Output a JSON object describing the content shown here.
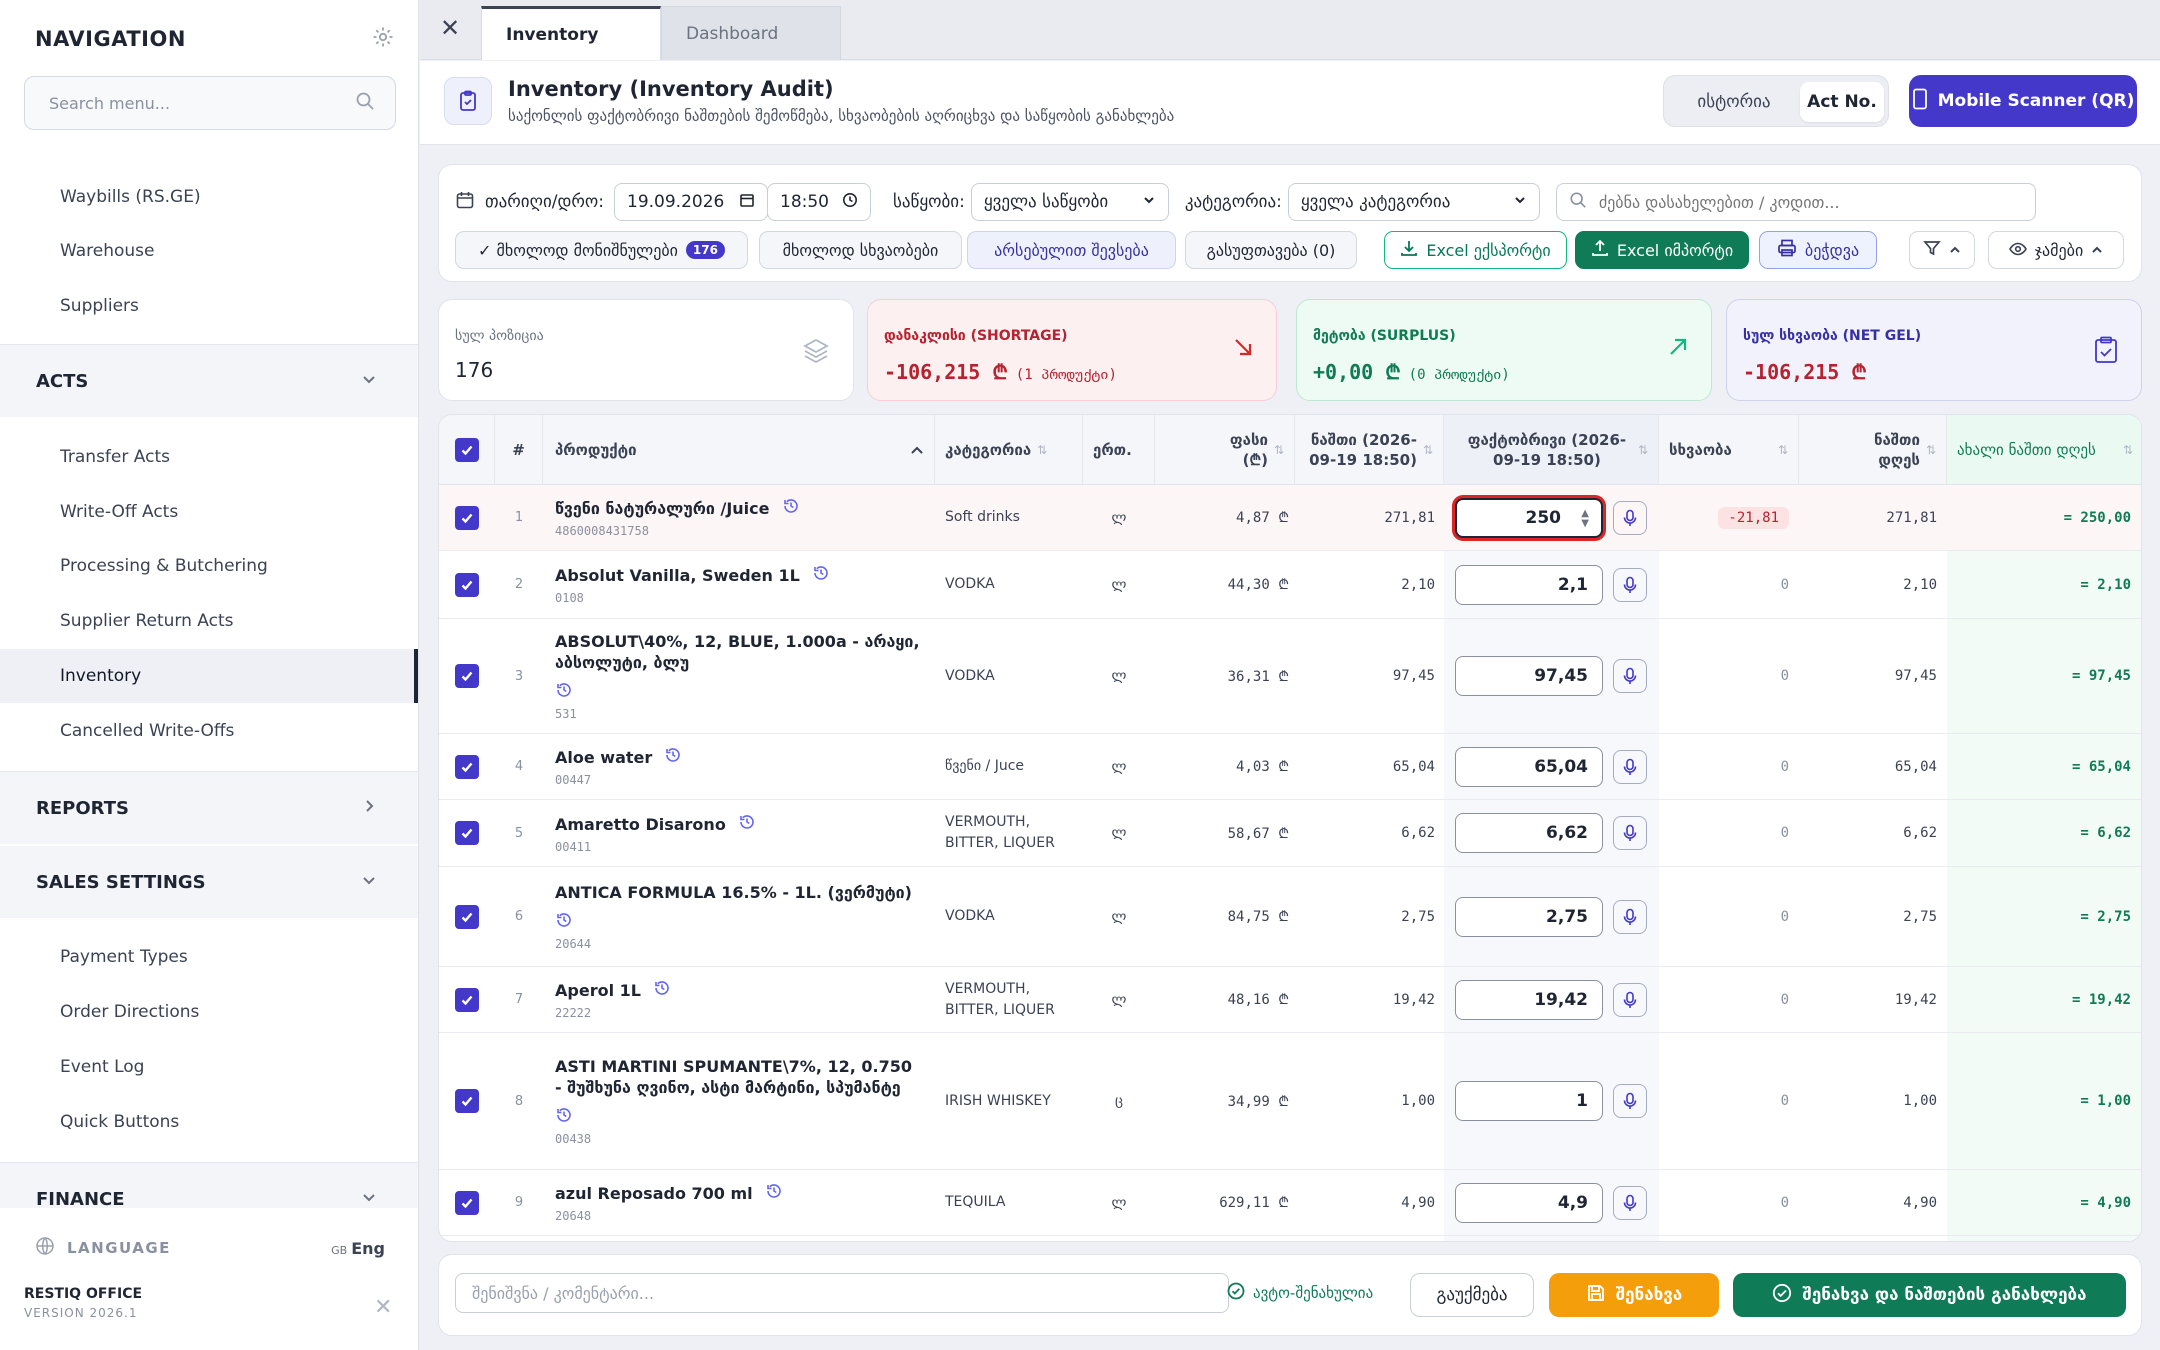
{
  "sidebar": {
    "title": "NAVIGATION",
    "search_placeholder": "Search menu...",
    "items_top": [
      "Waybills (RS.GE)",
      "Warehouse",
      "Suppliers"
    ],
    "acts_label": "ACTS",
    "acts_items": [
      "Transfer Acts",
      "Write-Off Acts",
      "Processing & Butchering",
      "Supplier Return Acts",
      "Inventory",
      "Cancelled Write-Offs"
    ],
    "reports_label": "REPORTS",
    "sales_label": "SALES SETTINGS",
    "sales_items": [
      "Payment Types",
      "Order Directions",
      "Event Log",
      "Quick Buttons"
    ],
    "finance_label": "FINANCE",
    "language_label": "LANGUAGE",
    "language_flag": "GB",
    "language_value": "Eng",
    "brand": "RESTIQ OFFICE",
    "version": "VERSION 2026.1"
  },
  "tabs": {
    "active": "Inventory",
    "inactive": "Dashboard"
  },
  "header": {
    "title": "Inventory (Inventory Audit)",
    "subtitle": "საქონლის ფაქტობრივი ნაშთების შემოწმება, სხვაობების აღრიცხვა და საწყობის განახლება",
    "history": "ისტორია",
    "act_no": "Act No.",
    "scanner": "Mobile Scanner (QR)"
  },
  "filters": {
    "date_label": "თარიღი/დრო:",
    "date_value": "19.09.2026",
    "time_value": "18:50",
    "warehouse_label": "საწყობი:",
    "warehouse_value": "ყველა საწყობი",
    "category_label": "კატეგორია:",
    "category_value": "ყველა კატეგორია",
    "search_placeholder": "ძებნა დასახელებით / კოდით...",
    "chip_marked": "✓ მხოლოდ მონიშნულები",
    "chip_marked_count": "176",
    "chip_diff": "მხოლოდ სხვაობები",
    "chip_fill": "არსებულით შევსება",
    "chip_clear": "გასუფთავება (0)",
    "excel_export": "Excel ექსპორტი",
    "excel_import": "Excel იმპორტი",
    "print": "ბეჭდვა",
    "totals": "ჯამები"
  },
  "stats": {
    "positions_label": "სულ პოზიცია",
    "positions_value": "176",
    "shortage_label": "დანაკლისი (SHORTAGE)",
    "shortage_value": "-106,215 ₾",
    "shortage_note": "(1 პროდუქტი)",
    "surplus_label": "მეტობა (SURPLUS)",
    "surplus_value": "+0,00 ₾",
    "surplus_note": "(0 პროდუქტი)",
    "net_label": "სულ სხვაობა (NET GEL)",
    "net_value": "-106,215 ₾"
  },
  "table": {
    "headers": {
      "num": "#",
      "product": "პროდუქტი",
      "category": "კატეგორია",
      "unit": "ერთ.",
      "price": "ფასი (₾)",
      "balance": "ნაშთი (2026-09-19 18:50)",
      "actual": "ფაქტობრივი (2026-09-19 18:50)",
      "diff": "სხვაობა",
      "balance_today": "ნაშთი დღეს",
      "new_balance": "ახალი ნაშთი დღეს"
    },
    "rows": [
      {
        "n": "1",
        "name": "წვენი ნატურალური /Juice",
        "code": "4860008431758",
        "cat": "Soft drinks",
        "unit": "ლ",
        "price": "4,87 ₾",
        "bal": "271,81",
        "act": "250",
        "diff": "-21,81",
        "today": "271,81",
        "new": "= 250,00"
      },
      {
        "n": "2",
        "name": "Absolut Vanilla, Sweden 1L",
        "code": "0108",
        "cat": "VODKA",
        "unit": "ლ",
        "price": "44,30 ₾",
        "bal": "2,10",
        "act": "2,1",
        "diff": "0",
        "today": "2,10",
        "new": "= 2,10"
      },
      {
        "n": "3",
        "name": "ABSOLUT\\40%, 12, BLUE, 1.000a - არაყი, აბსოლუტი, ბლუ",
        "code": "531",
        "cat": "VODKA",
        "unit": "ლ",
        "price": "36,31 ₾",
        "bal": "97,45",
        "act": "97,45",
        "diff": "0",
        "today": "97,45",
        "new": "= 97,45"
      },
      {
        "n": "4",
        "name": "Aloe water",
        "code": "00447",
        "cat": "წვენი / Juce",
        "unit": "ლ",
        "price": "4,03 ₾",
        "bal": "65,04",
        "act": "65,04",
        "diff": "0",
        "today": "65,04",
        "new": "= 65,04"
      },
      {
        "n": "5",
        "name": "Amaretto Disarono",
        "code": "00411",
        "cat": "VERMOUTH, BITTER, LIQUER",
        "unit": "ლ",
        "price": "58,67 ₾",
        "bal": "6,62",
        "act": "6,62",
        "diff": "0",
        "today": "6,62",
        "new": "= 6,62"
      },
      {
        "n": "6",
        "name": "ANTICA FORMULA 16.5% - 1L. (ვერმუტი)",
        "code": "20644",
        "cat": "VODKA",
        "unit": "ლ",
        "price": "84,75 ₾",
        "bal": "2,75",
        "act": "2,75",
        "diff": "0",
        "today": "2,75",
        "new": "= 2,75"
      },
      {
        "n": "7",
        "name": "Aperol 1L",
        "code": "22222",
        "cat": "VERMOUTH, BITTER, LIQUER",
        "unit": "ლ",
        "price": "48,16 ₾",
        "bal": "19,42",
        "act": "19,42",
        "diff": "0",
        "today": "19,42",
        "new": "= 19,42"
      },
      {
        "n": "8",
        "name": "ASTI MARTINI SPUMANTE\\7%, 12, 0.750 - შუშხუნა ღვინო, ასტი მარტინი, სპუმანტე",
        "code": "00438",
        "cat": "IRISH WHISKEY",
        "unit": "ც",
        "price": "34,99 ₾",
        "bal": "1,00",
        "act": "1",
        "diff": "0",
        "today": "1,00",
        "new": "= 1,00"
      },
      {
        "n": "9",
        "name": "azul Reposado 700 ml",
        "code": "20648",
        "cat": "TEQUILA",
        "unit": "ლ",
        "price": "629,11 ₾",
        "bal": "4,90",
        "act": "4,9",
        "diff": "0",
        "today": "4,90",
        "new": "= 4,90"
      }
    ]
  },
  "footer": {
    "note_placeholder": "შენიშვნა / კომენტარი...",
    "autosave": "ავტო-შენახულია",
    "cancel": "გაუქმება",
    "save": "შენახვა",
    "save_distribute": "შენახვა და ნაშთების განახლება"
  },
  "colors": {
    "accent": "#4338ca",
    "success": "#0f7b57",
    "danger": "#b4232f",
    "warning": "#f59e0b"
  }
}
